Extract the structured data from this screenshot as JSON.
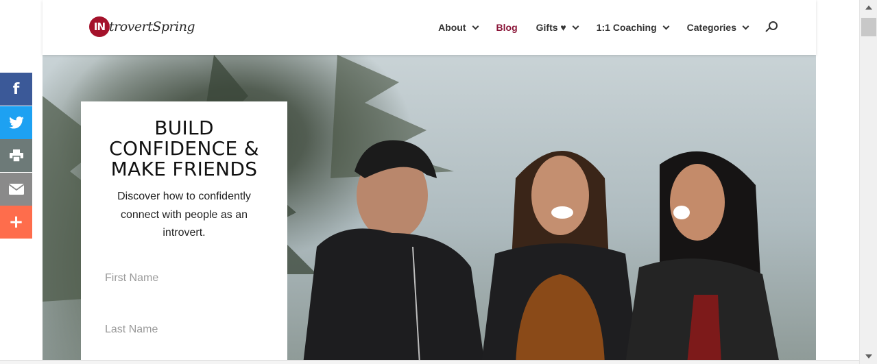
{
  "logo": {
    "mark": "IN",
    "text": "trovertSpring"
  },
  "nav": {
    "items": [
      {
        "label": "About",
        "dropdown": true,
        "active": false
      },
      {
        "label": "Blog",
        "dropdown": false,
        "active": true
      },
      {
        "label": "Gifts ♥",
        "dropdown": true,
        "active": false
      },
      {
        "label": "1:1 Coaching",
        "dropdown": true,
        "active": false
      },
      {
        "label": "Categories",
        "dropdown": true,
        "active": false
      }
    ],
    "search_icon": "search-icon"
  },
  "hero": {
    "title": "BUILD CONFIDENCE & MAKE FRIENDS",
    "subtitle": "Discover how to confidently connect with people as an introvert.",
    "first_name_placeholder": "First Name",
    "last_name_placeholder": "Last Name"
  },
  "share": {
    "facebook": "f",
    "plus": "+"
  },
  "colors": {
    "accent": "#8a1538",
    "logo_red": "#a4122b",
    "facebook": "#3b5998",
    "twitter": "#1da1f2",
    "print": "#6d7a78",
    "email": "#8a8a8a",
    "more": "#fe6d4c"
  }
}
